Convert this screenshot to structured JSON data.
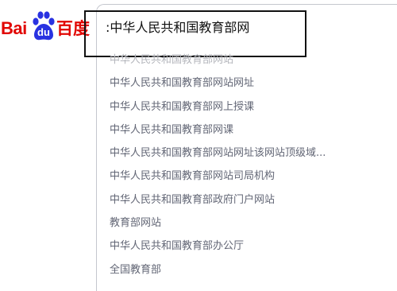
{
  "logo": {
    "text_left": "Bai",
    "text_paw": "du",
    "text_right": "百度",
    "brand_color": "#e10602"
  },
  "search": {
    "cursor": ":",
    "query": "中华人民共和国教育部网"
  },
  "suggestions": [
    "中华人民共和国教育部网站",
    "中华人民共和国教育部网站网址",
    "中华人民共和国教育部网上授课",
    "中华人民共和国教育部网课",
    "中华人民共和国教育部网站网址该网站顶级域...",
    "中华人民共和国教育部网站司局机构",
    "中华人民共和国教育部政府门户网站",
    "教育部网站",
    "中华人民共和国教育部办公厅",
    "全国教育部"
  ]
}
